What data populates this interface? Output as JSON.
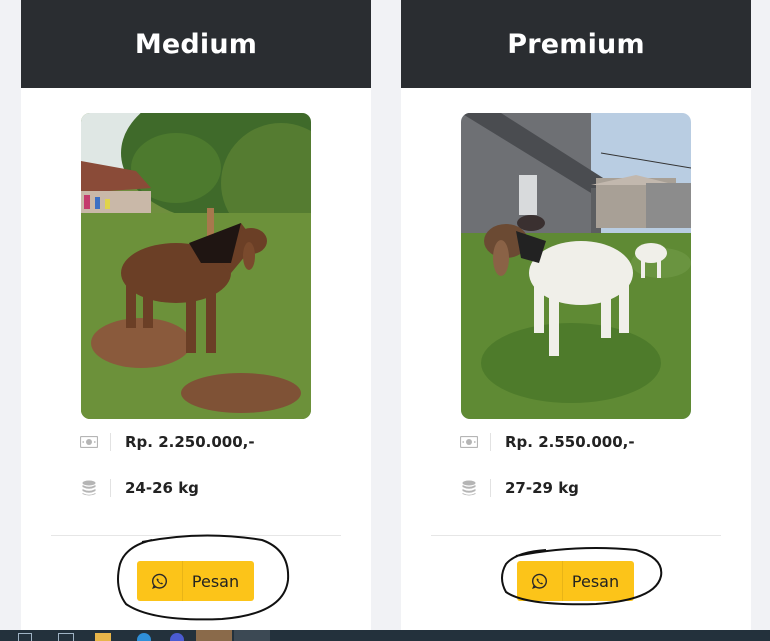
{
  "cards": [
    {
      "title": "Medium",
      "price": "Rp. 2.250.000,-",
      "weight": "24-26 kg",
      "button_label": "Pesan"
    },
    {
      "title": "Premium",
      "price": "Rp. 2.550.000,-",
      "weight": "27-29 kg",
      "button_label": "Pesan"
    }
  ],
  "icons": {
    "price": "money-icon",
    "weight": "coins-stack-icon",
    "button": "whatsapp-icon"
  },
  "colors": {
    "header_bg": "#2a2d31",
    "button_bg": "#fcc419",
    "page_bg": "#f1f2f5"
  }
}
